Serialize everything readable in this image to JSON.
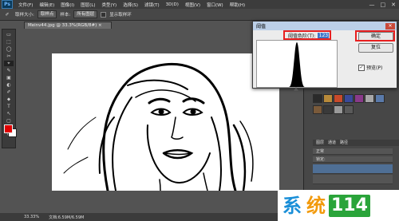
{
  "app": {
    "logo": "Ps"
  },
  "menu": [
    "文件(F)",
    "编辑(E)",
    "图像(I)",
    "图层(L)",
    "类型(Y)",
    "选择(S)",
    "滤镜(T)",
    "3D(D)",
    "视图(V)",
    "窗口(W)",
    "帮助(H)"
  ],
  "window_controls": {
    "minimize": "—",
    "maximize": "□",
    "close": "✕"
  },
  "options_bar": {
    "style_label": "取样大小:",
    "style_value": "取样点",
    "sample_label": "样本:",
    "sample_value": "所有图层",
    "show_ring_label": "显示取样环"
  },
  "document_tab": {
    "label": "Meinv44.jpg @ 33.3%(RGB/8#) ×"
  },
  "tools": [
    "▭",
    "⬚",
    "◯",
    "✂",
    "⌖",
    "✎",
    "▣",
    "◐",
    "✐",
    "⬥",
    "T",
    "↖",
    "▢",
    "✋",
    "⚲"
  ],
  "colors": {
    "foreground": "#e00000",
    "background": "#ffffff"
  },
  "status_bar": {
    "zoom": "33.33%",
    "doc_size": "文档:6.59M/6.59M"
  },
  "layers_panel": {
    "tabs": [
      "图层",
      "通道",
      "路径"
    ],
    "kind_label": "正常",
    "opacity_label": "不透明度:",
    "lock_label": "锁定:"
  },
  "dialog": {
    "title": "阈值",
    "close": "✕",
    "threshold_label": "阈值色阶(T):",
    "threshold_value": "123",
    "ok_label": "确定",
    "reset_label": "复位",
    "preview_label": "预览(P)",
    "preview_checked": true
  },
  "watermark": {
    "char1": "系",
    "char2": "统",
    "num": "114"
  }
}
